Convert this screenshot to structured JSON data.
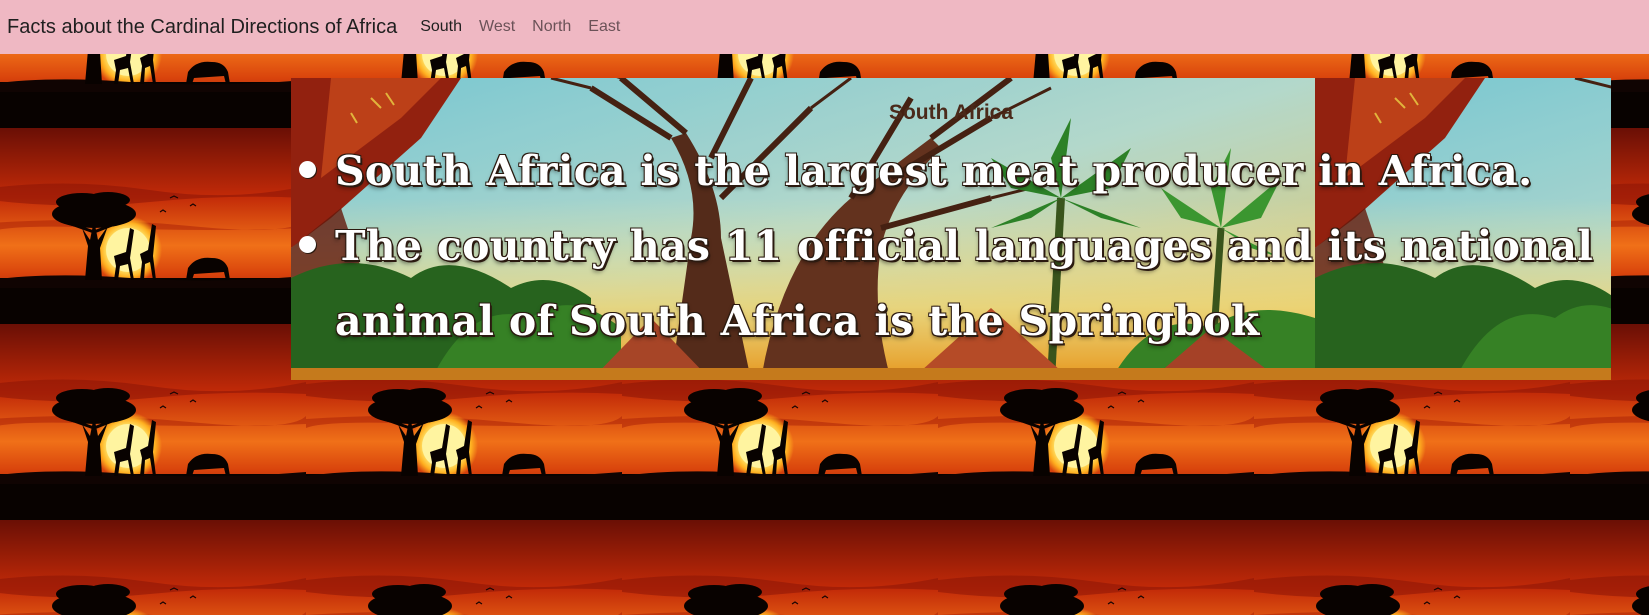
{
  "navbar": {
    "brand": "Facts about the Cardinal Directions of Africa",
    "links": [
      "South",
      "West",
      "North",
      "East"
    ],
    "active": "South"
  },
  "section": {
    "title": "South Africa",
    "facts": [
      "South Africa is the largest meat producer in Africa.",
      "The country has 11 official languages and its national animal of South Africa is the Springbok"
    ]
  },
  "colors": {
    "navbar_bg": "#efb8c3",
    "sunset_orange": "#e0440e",
    "sun": "#fff07a",
    "fact_text": "#ffffff"
  },
  "icons": [
    "sunset-background-image",
    "african-painting-image"
  ]
}
